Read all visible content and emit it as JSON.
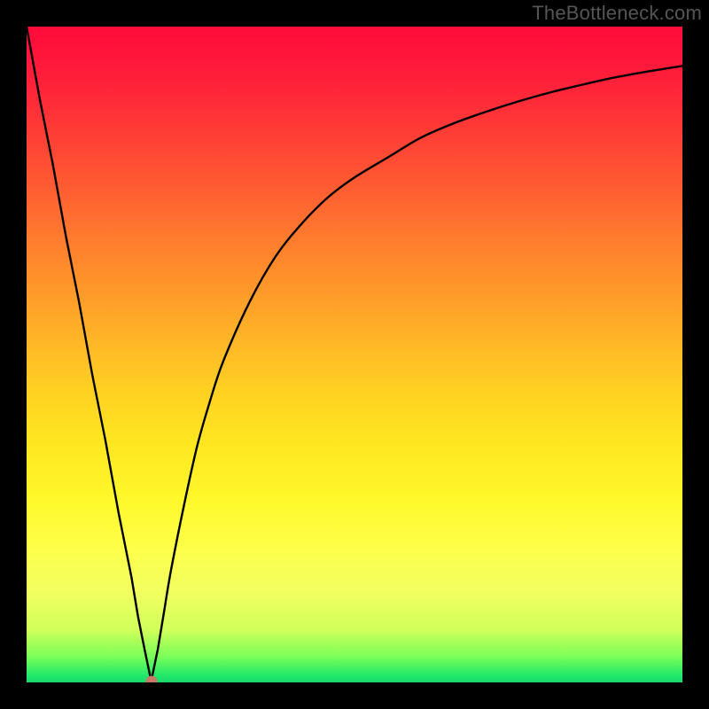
{
  "watermark": "TheBottleneck.com",
  "colors": {
    "frame_bg": "#000000",
    "curve_stroke": "#000000",
    "marker_fill": "#c77a68",
    "gradient_top": "#ff0a3a",
    "gradient_mid": "#ffe820",
    "gradient_bottom": "#18d86a"
  },
  "chart_data": {
    "type": "line",
    "title": "",
    "xlabel": "",
    "ylabel": "",
    "x_range": [
      0,
      100
    ],
    "y_range": [
      0,
      100
    ],
    "marker": {
      "x": 19,
      "y": 0.2
    },
    "series": [
      {
        "name": "curve",
        "x": [
          0,
          2,
          4,
          6,
          8,
          10,
          12,
          14,
          16,
          17,
          18,
          19,
          20,
          21,
          22,
          24,
          26,
          28,
          30,
          34,
          38,
          42,
          46,
          50,
          55,
          60,
          65,
          70,
          75,
          80,
          85,
          90,
          95,
          100
        ],
        "y": [
          100,
          89,
          79,
          68,
          58,
          47,
          37,
          26,
          16,
          10,
          5,
          0.2,
          5,
          11,
          17,
          27,
          36,
          43,
          49,
          58,
          65,
          70,
          74,
          77,
          80,
          83,
          85.2,
          87,
          88.6,
          90,
          91.2,
          92.3,
          93.2,
          94
        ]
      }
    ],
    "ylim": [
      0,
      100
    ],
    "xlim": [
      0,
      100
    ],
    "grid": false,
    "legend": false
  }
}
